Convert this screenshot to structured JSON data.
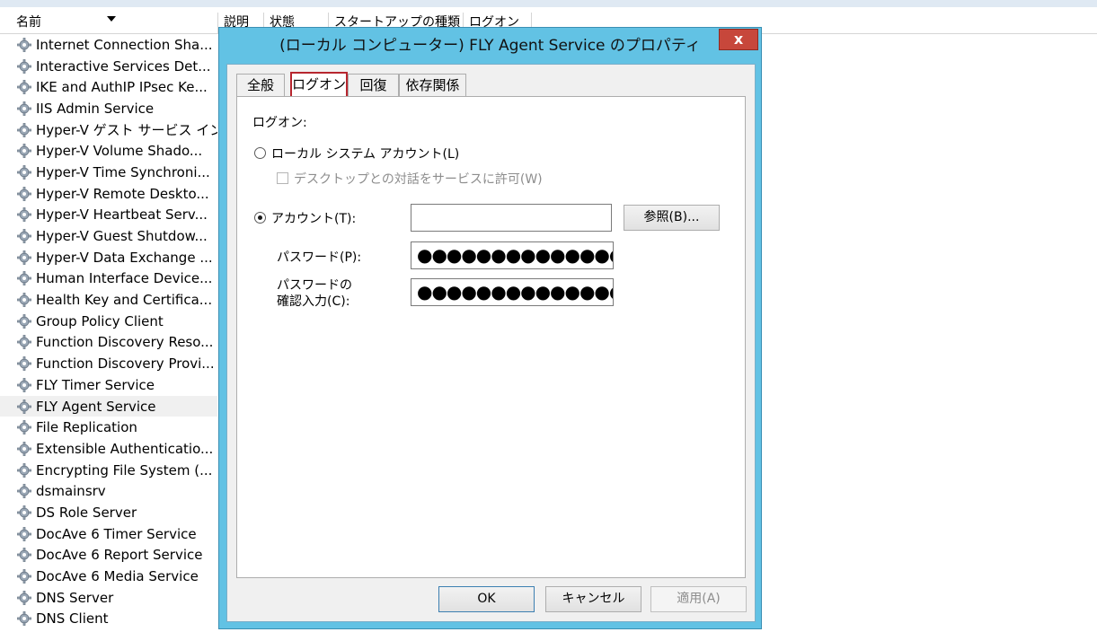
{
  "columns": [
    {
      "label": "名前"
    },
    {
      "label": "説明"
    },
    {
      "label": "状態"
    },
    {
      "label": "スタートアップの種類"
    },
    {
      "label": "ログオン"
    }
  ],
  "services": [
    "Internet Connection Sha...",
    "Interactive Services Det...",
    "IKE and AuthIP IPsec Ke...",
    "IIS Admin Service",
    "Hyper-V ゲスト サービス イン...",
    "Hyper-V Volume Shado...",
    "Hyper-V Time Synchroni...",
    "Hyper-V Remote Deskto...",
    "Hyper-V Heartbeat Serv...",
    "Hyper-V Guest Shutdow...",
    "Hyper-V Data Exchange ...",
    "Human Interface Device...",
    "Health Key and Certifica...",
    "Group Policy Client",
    "Function Discovery Reso...",
    "Function Discovery Provi...",
    "FLY Timer Service",
    "FLY Agent Service",
    "File Replication",
    "Extensible Authenticatio...",
    "Encrypting File System (...",
    "dsmainsrv",
    "DS Role Server",
    "DocAve 6 Timer Service",
    "DocAve 6 Report Service",
    "DocAve 6 Media Service",
    "DNS Server",
    "DNS Client"
  ],
  "selected_service": "FLY Agent Service",
  "dialog": {
    "title": "(ローカル コンピューター) FLY Agent Service のプロパティ",
    "close_label": "x",
    "tabs": [
      "全般",
      "ログオン",
      "回復",
      "依存関係"
    ],
    "active_tab": "ログオン",
    "logon_section_label": "ログオン:",
    "local_system_label": "ローカル システム アカウント(L)",
    "desktop_interact_label": "デスクトップとの対話をサービスに許可(W)",
    "account_label": "アカウント(T):",
    "account_value": "",
    "browse_label": "参照(B)...",
    "password_label": "パスワード(P):",
    "password_value": "●●●●●●●●●●●●●●●",
    "confirm_label_line1": "パスワードの",
    "confirm_label_line2": "確認入力(C):",
    "confirm_value": "●●●●●●●●●●●●●●●",
    "ok_label": "OK",
    "cancel_label": "キャンセル",
    "apply_label": "適用(A)"
  },
  "colors": {
    "dialog_frame": "#62c2e4",
    "close_button": "#c7473b",
    "active_tab_border": "#b7262f"
  }
}
